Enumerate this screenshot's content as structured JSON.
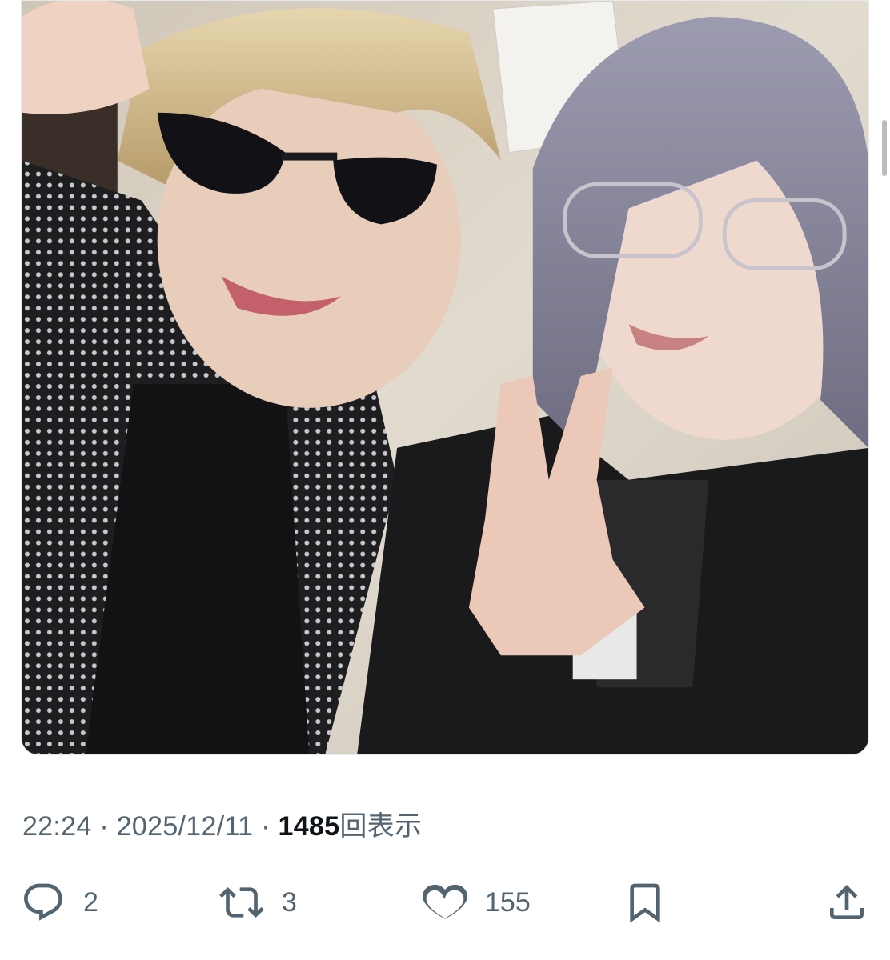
{
  "tweet": {
    "time": "22:24",
    "separator1": " · ",
    "date": "2025/12/11",
    "separator2": " · ",
    "views_count": "1485",
    "views_suffix": "回表示"
  },
  "actions": {
    "replies": "2",
    "reposts": "3",
    "likes": "155"
  },
  "icons": {
    "reply": "reply-icon",
    "repost": "repost-icon",
    "like": "heart-icon",
    "bookmark": "bookmark-icon",
    "share": "share-icon"
  },
  "colors": {
    "meta_text": "#536471",
    "primary_text": "#0f1419"
  }
}
